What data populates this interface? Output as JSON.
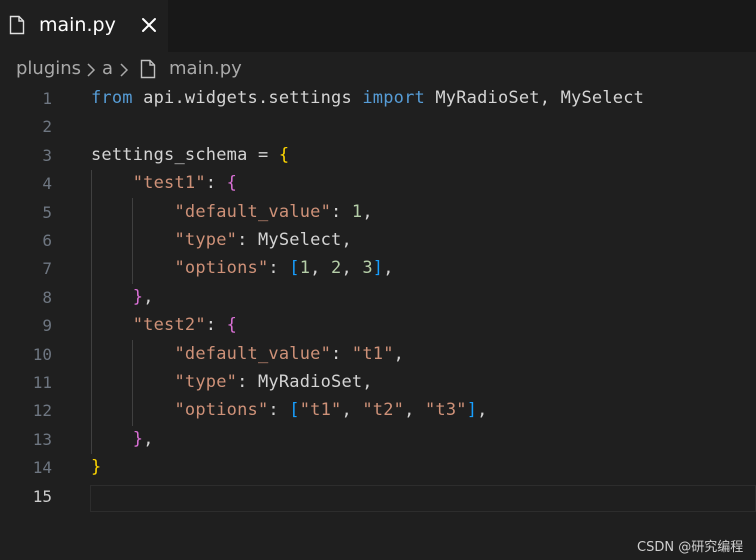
{
  "tab": {
    "label": "main.py",
    "icon": "file-icon",
    "close_icon": "close-icon"
  },
  "breadcrumb": {
    "items": [
      "plugins",
      "a",
      "main.py"
    ]
  },
  "editor": {
    "active_line": 15,
    "lines": [
      {
        "n": "1",
        "tokens": [
          [
            "kw",
            "from"
          ],
          [
            "id",
            " api.widgets.settings "
          ],
          [
            "kw",
            "import"
          ],
          [
            "id",
            " MyRadioSet, MySelect"
          ]
        ]
      },
      {
        "n": "2",
        "tokens": []
      },
      {
        "n": "3",
        "tokens": [
          [
            "id",
            "settings_schema = "
          ],
          [
            "b1",
            "{"
          ]
        ]
      },
      {
        "n": "4",
        "tokens": [
          [
            "id",
            "    "
          ],
          [
            "str",
            "\"test1\""
          ],
          [
            "id",
            ": "
          ],
          [
            "b2",
            "{"
          ]
        ]
      },
      {
        "n": "5",
        "tokens": [
          [
            "id",
            "        "
          ],
          [
            "str",
            "\"default_value\""
          ],
          [
            "id",
            ": "
          ],
          [
            "num",
            "1"
          ],
          [
            "id",
            ","
          ]
        ]
      },
      {
        "n": "6",
        "tokens": [
          [
            "id",
            "        "
          ],
          [
            "str",
            "\"type\""
          ],
          [
            "id",
            ": MySelect,"
          ]
        ]
      },
      {
        "n": "7",
        "tokens": [
          [
            "id",
            "        "
          ],
          [
            "str",
            "\"options\""
          ],
          [
            "id",
            ": "
          ],
          [
            "b3",
            "["
          ],
          [
            "num",
            "1"
          ],
          [
            "id",
            ", "
          ],
          [
            "num",
            "2"
          ],
          [
            "id",
            ", "
          ],
          [
            "num",
            "3"
          ],
          [
            "b3",
            "]"
          ],
          [
            "id",
            ","
          ]
        ]
      },
      {
        "n": "8",
        "tokens": [
          [
            "id",
            "    "
          ],
          [
            "b2",
            "}"
          ],
          [
            "id",
            ","
          ]
        ]
      },
      {
        "n": "9",
        "tokens": [
          [
            "id",
            "    "
          ],
          [
            "str",
            "\"test2\""
          ],
          [
            "id",
            ": "
          ],
          [
            "b2",
            "{"
          ]
        ]
      },
      {
        "n": "10",
        "tokens": [
          [
            "id",
            "        "
          ],
          [
            "str",
            "\"default_value\""
          ],
          [
            "id",
            ": "
          ],
          [
            "str",
            "\"t1\""
          ],
          [
            "id",
            ","
          ]
        ]
      },
      {
        "n": "11",
        "tokens": [
          [
            "id",
            "        "
          ],
          [
            "str",
            "\"type\""
          ],
          [
            "id",
            ": MyRadioSet,"
          ]
        ]
      },
      {
        "n": "12",
        "tokens": [
          [
            "id",
            "        "
          ],
          [
            "str",
            "\"options\""
          ],
          [
            "id",
            ": "
          ],
          [
            "b3",
            "["
          ],
          [
            "str",
            "\"t1\""
          ],
          [
            "id",
            ", "
          ],
          [
            "str",
            "\"t2\""
          ],
          [
            "id",
            ", "
          ],
          [
            "str",
            "\"t3\""
          ],
          [
            "b3",
            "]"
          ],
          [
            "id",
            ","
          ]
        ]
      },
      {
        "n": "13",
        "tokens": [
          [
            "id",
            "    "
          ],
          [
            "b2",
            "}"
          ],
          [
            "id",
            ","
          ]
        ]
      },
      {
        "n": "14",
        "tokens": [
          [
            "b1",
            "}"
          ]
        ]
      },
      {
        "n": "15",
        "tokens": []
      }
    ]
  },
  "watermark": "CSDN @研究编程",
  "colors": {
    "background": "#1f1f1f",
    "keyword": "#569cd6",
    "string": "#ce9178",
    "number": "#b5cea8",
    "bracket_level1": "#ffd700",
    "bracket_level2": "#da70d6",
    "bracket_level3": "#179fff"
  }
}
